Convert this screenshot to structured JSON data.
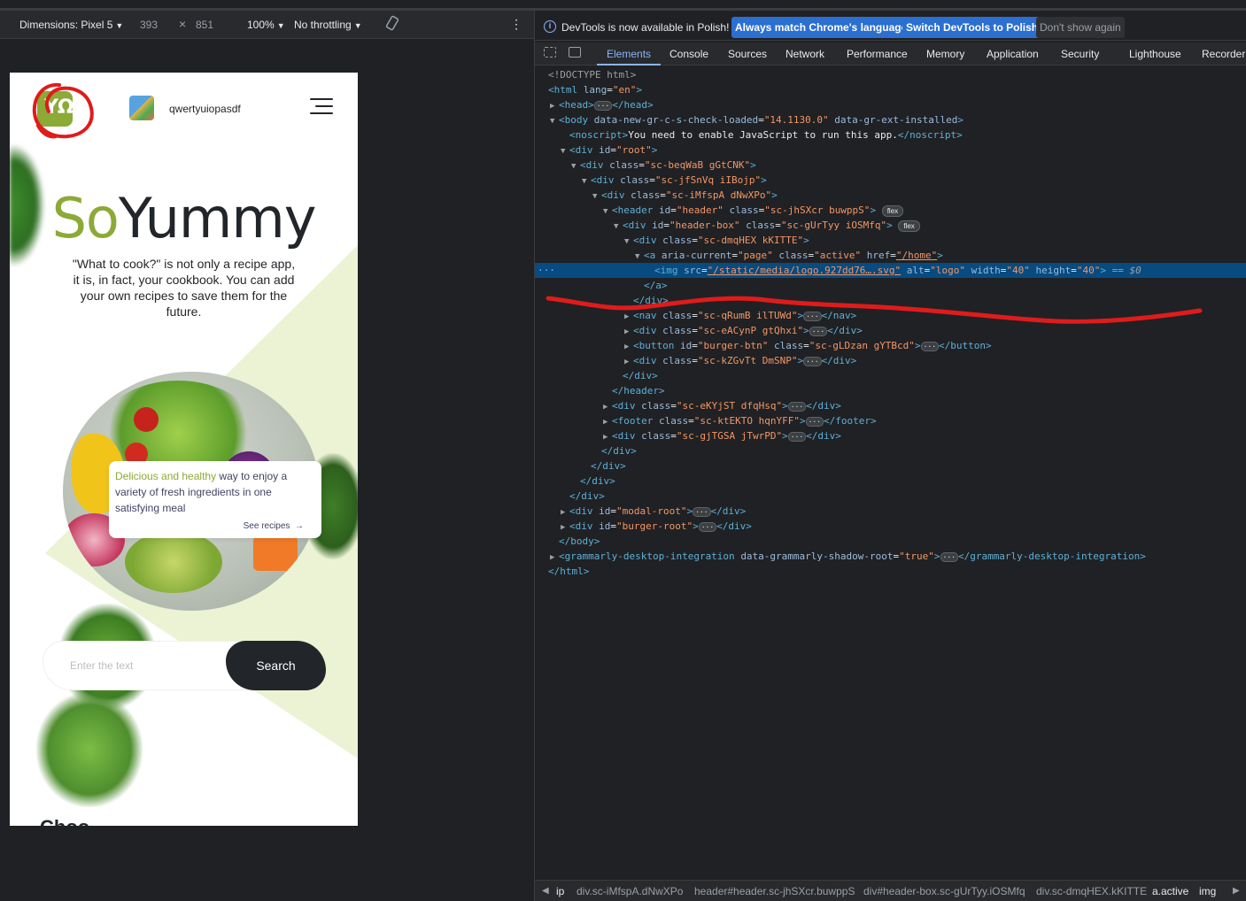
{
  "device_toolbar": {
    "device": "Dimensions: Pixel 5",
    "width": "393",
    "x_sep": "×",
    "height": "851",
    "zoom": "100%",
    "throttling": "No throttling",
    "more": "⋮"
  },
  "app": {
    "logo_alt": "logo",
    "logo_glyph": "ΥΩ",
    "username": "qwertyuiopasdf",
    "title_accent": "So",
    "title_rest": "Yummy",
    "tagline": "\"What to cook?\" is not only a recipe app, it is, in fact, your cookbook. You can add your own recipes to save them for the future.",
    "card_highlight": "Delicious and healthy",
    "card_text": " way to enjoy a variety of fresh ingredients in one satisfying meal",
    "card_link": "See recipes",
    "card_arrow": "→",
    "search_placeholder": "Enter the text",
    "search_button": "Search",
    "next_heading": "Choo"
  },
  "devtools": {
    "info_icon": "i",
    "info_message": "DevTools is now available in Polish!",
    "btn_match": "Always match Chrome's language",
    "btn_switch": "Switch DevTools to Polish",
    "btn_dismiss": "Don't show again",
    "tabs": [
      "Elements",
      "Console",
      "Sources",
      "Network",
      "Performance",
      "Memory",
      "Application",
      "Security",
      "Lighthouse",
      "Recorder"
    ],
    "active_tab": "Elements",
    "breadcrumbs": [
      "ip",
      "div.sc-iMfspA.dNwXPo",
      "header#header.sc-jhSXcr.buwppS",
      "div#header-box.sc-gUrTyy.iOSMfq",
      "div.sc-dmqHEX.kKITTE",
      "a.active",
      "img"
    ]
  },
  "colors": {
    "accent": "#8baa36",
    "dark": "#22252a",
    "devtools_selection": "#074b80",
    "annotation_red": "#e01b1b"
  }
}
